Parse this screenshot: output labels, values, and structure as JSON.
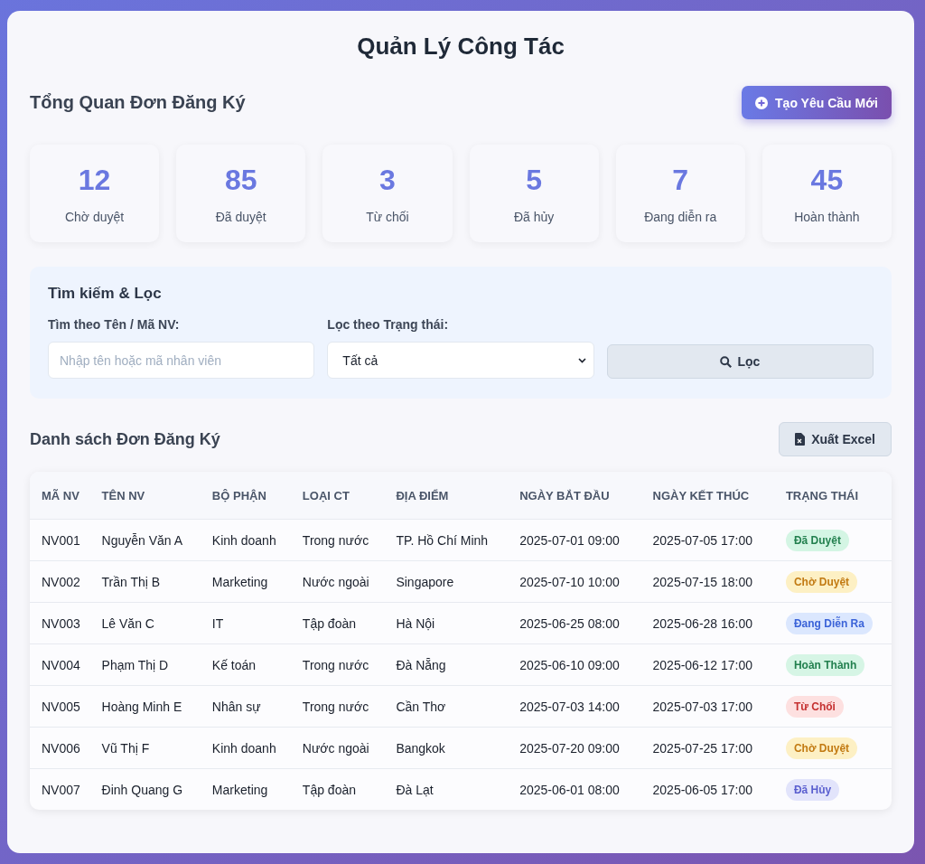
{
  "title": "Quản Lý Công Tác",
  "overview": {
    "heading": "Tổng Quan Đơn Đăng Ký",
    "new_button": "Tạo Yêu Cầu Mới"
  },
  "stats": [
    {
      "value": "12",
      "label": "Chờ duyệt"
    },
    {
      "value": "85",
      "label": "Đã duyệt"
    },
    {
      "value": "3",
      "label": "Từ chối"
    },
    {
      "value": "5",
      "label": "Đã hủy"
    },
    {
      "value": "7",
      "label": "Đang diễn ra"
    },
    {
      "value": "45",
      "label": "Hoàn thành"
    }
  ],
  "filter": {
    "heading": "Tìm kiếm & Lọc",
    "search_label": "Tìm theo Tên / Mã NV:",
    "search_placeholder": "Nhập tên hoặc mã nhân viên",
    "status_label": "Lọc theo Trạng thái:",
    "status_value": "Tất cả",
    "filter_button": "Lọc"
  },
  "list": {
    "heading": "Danh sách Đơn Đăng Ký",
    "export_button": "Xuất Excel"
  },
  "table": {
    "columns": [
      "MÃ NV",
      "TÊN NV",
      "BỘ PHẬN",
      "LOẠI CT",
      "ĐỊA ĐIỂM",
      "NGÀY BẮT ĐẦU",
      "NGÀY KẾT THÚC",
      "TRẠNG THÁI"
    ],
    "rows": [
      {
        "cells": [
          "NV001",
          "Nguyễn Văn A",
          "Kinh doanh",
          "Trong nước",
          "TP. Hồ Chí Minh",
          "2025-07-01 09:00",
          "2025-07-05 17:00"
        ],
        "status": {
          "text": "Đã Duyệt",
          "kind": "approved"
        }
      },
      {
        "cells": [
          "NV002",
          "Trần Thị B",
          "Marketing",
          "Nước ngoài",
          "Singapore",
          "2025-07-10 10:00",
          "2025-07-15 18:00"
        ],
        "status": {
          "text": "Chờ Duyệt",
          "kind": "pending"
        }
      },
      {
        "cells": [
          "NV003",
          "Lê Văn C",
          "IT",
          "Tập đoàn",
          "Hà Nội",
          "2025-06-25 08:00",
          "2025-06-28 16:00"
        ],
        "status": {
          "text": "Đang Diễn Ra",
          "kind": "ongoing"
        }
      },
      {
        "cells": [
          "NV004",
          "Phạm Thị D",
          "Kế toán",
          "Trong nước",
          "Đà Nẵng",
          "2025-06-10 09:00",
          "2025-06-12 17:00"
        ],
        "status": {
          "text": "Hoàn Thành",
          "kind": "completed"
        }
      },
      {
        "cells": [
          "NV005",
          "Hoàng Minh E",
          "Nhân sự",
          "Trong nước",
          "Cần Thơ",
          "2025-07-03 14:00",
          "2025-07-03 17:00"
        ],
        "status": {
          "text": "Từ Chối",
          "kind": "rejected"
        }
      },
      {
        "cells": [
          "NV006",
          "Vũ Thị F",
          "Kinh doanh",
          "Nước ngoài",
          "Bangkok",
          "2025-07-20 09:00",
          "2025-07-25 17:00"
        ],
        "status": {
          "text": "Chờ Duyệt",
          "kind": "pending"
        }
      },
      {
        "cells": [
          "NV007",
          "Đinh Quang G",
          "Marketing",
          "Tập đoàn",
          "Đà Lạt",
          "2025-06-01 08:00",
          "2025-06-05 17:00"
        ],
        "status": {
          "text": "Đã Hủy",
          "kind": "cancelled"
        }
      }
    ]
  }
}
